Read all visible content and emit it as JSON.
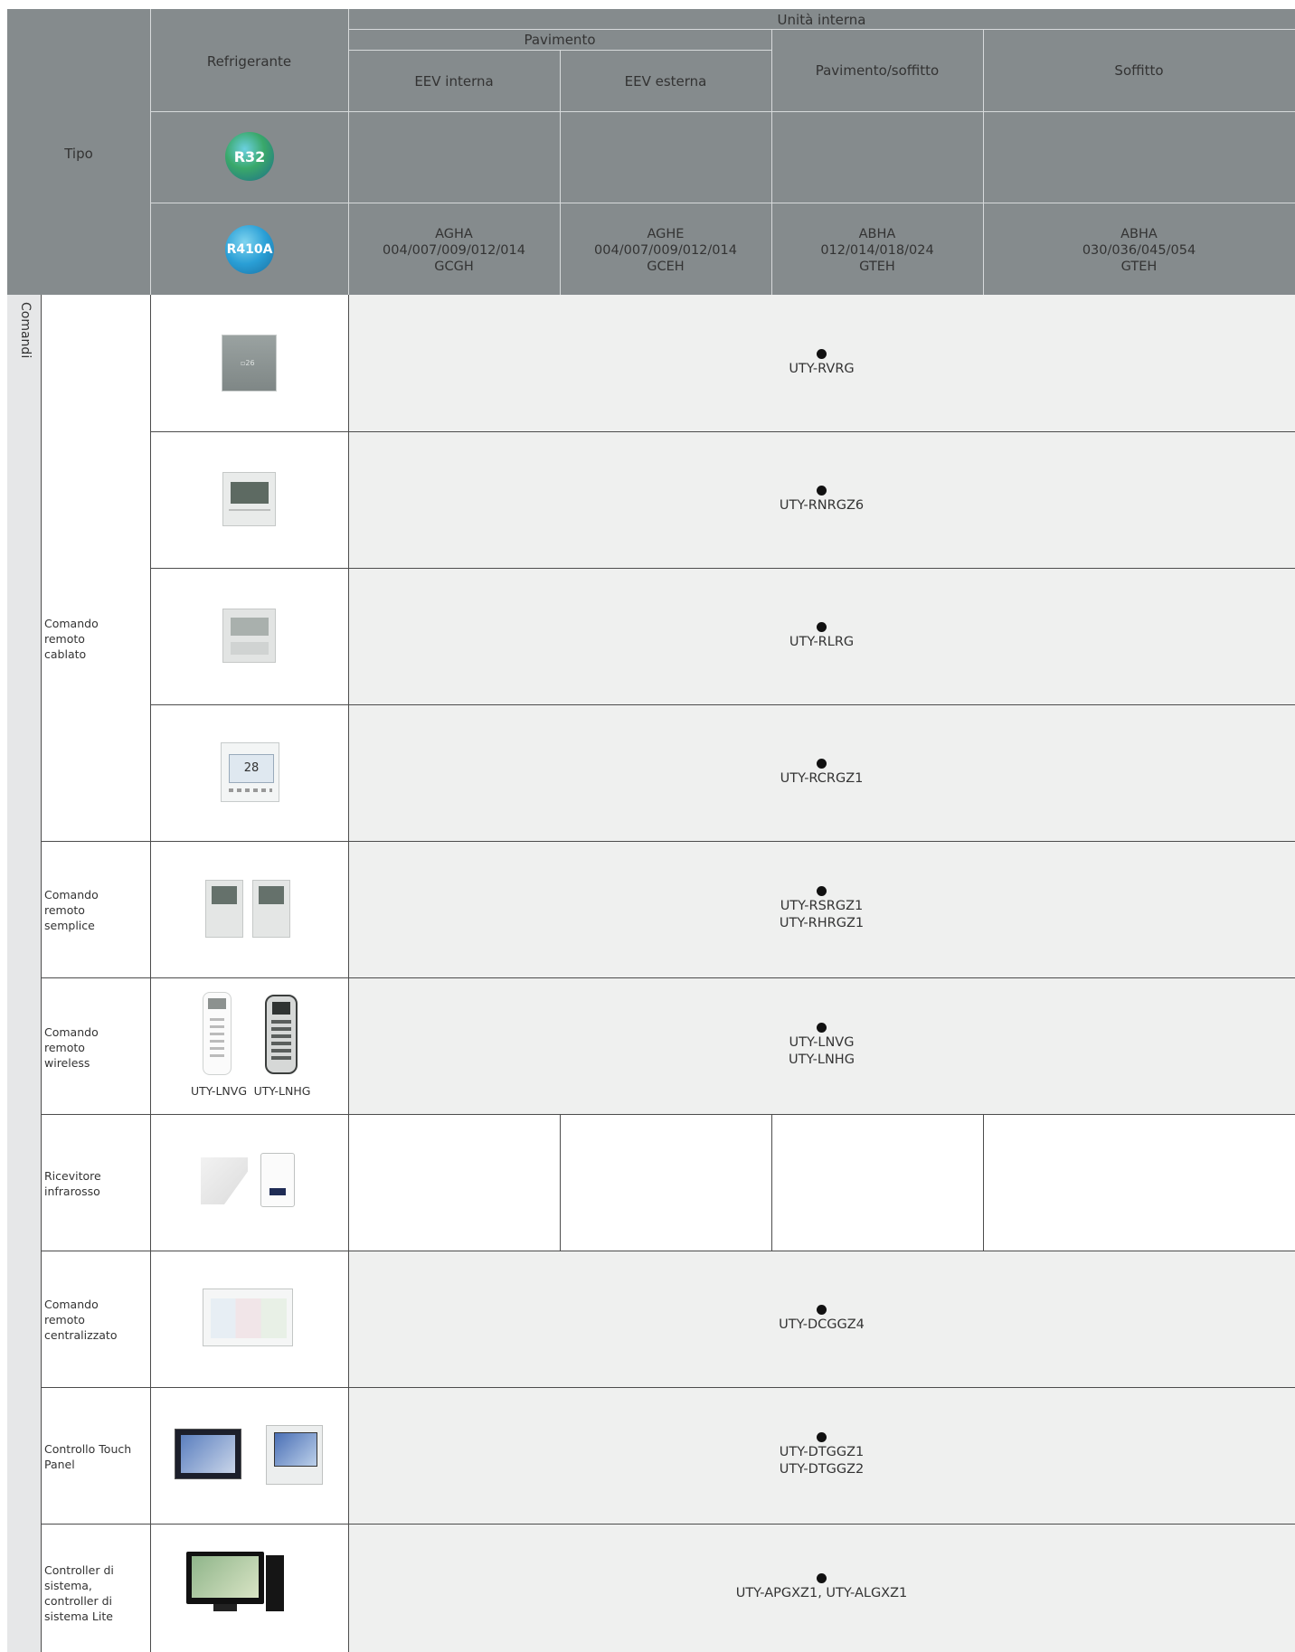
{
  "header": {
    "tipo": "Tipo",
    "refrigerante": "Refrigerante",
    "unita_interna": "Unità interna",
    "pavimento": "Pavimento",
    "columns": [
      "EEV interna",
      "EEV esterna",
      "Pavimento/soffitto",
      "Soffitto"
    ],
    "r32_label": "R32",
    "r410a_label": "R410A",
    "models": [
      "AGHA\n004/007/009/012/014\nGCGH",
      "AGHE\n004/007/009/012/014\nGCEH",
      "ABHA\n012/014/018/024\nGTEH",
      "ABHA\n030/036/045/054\nGTEH"
    ]
  },
  "side_label": "Comandi",
  "groups": [
    {
      "label": "Comando\nremoto\ncablato"
    },
    {
      "label": "Comando\nremoto\nsemplice"
    },
    {
      "label": "Comando\nremoto\nwireless"
    },
    {
      "label": "Ricevitore\ninfrarosso"
    },
    {
      "label": "Comando\nremoto\ncentralizzato"
    },
    {
      "label": "Controllo Touch\nPanel"
    },
    {
      "label": "Controller di\nsistema,\ncontroller di\nsistema Lite"
    }
  ],
  "rows": [
    {
      "value": "UTY-RVRG"
    },
    {
      "value": "UTY-RNRGZ6"
    },
    {
      "value": "UTY-RLRG"
    },
    {
      "value": "UTY-RCRGZ1"
    },
    {
      "value": "UTY-RSRGZ1\nUTY-RHRGZ1"
    },
    {
      "value": "UTY-LNVG\nUTY-LNHG"
    },
    {
      "value": ""
    },
    {
      "value": "UTY-DCGGZ4"
    },
    {
      "value": "UTY-DTGGZ1\nUTY-DTGGZ2"
    },
    {
      "value": "UTY-APGXZ1, UTY-ALGXZ1"
    }
  ],
  "wireless_captions": [
    "UTY-LNVG",
    "UTY-LNHG"
  ],
  "dot_symbol": "●"
}
